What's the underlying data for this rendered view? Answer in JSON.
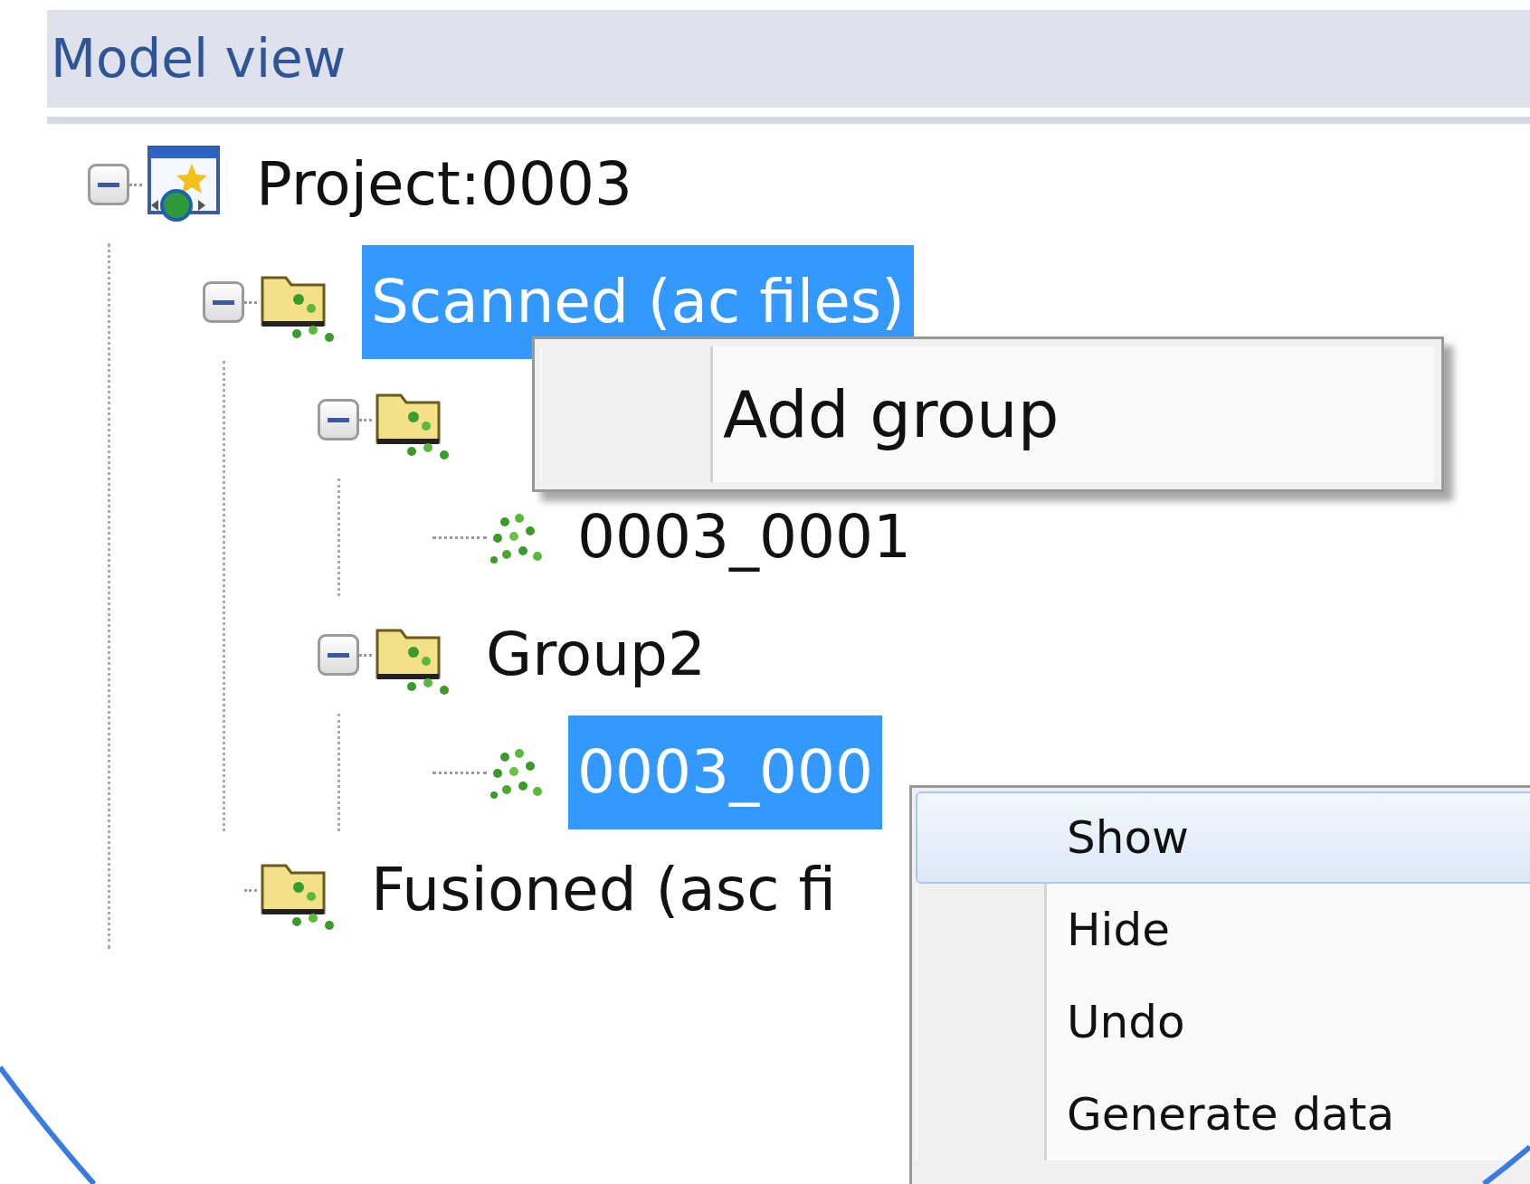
{
  "panel": {
    "title": "Model view"
  },
  "tree": [
    {
      "kind": "project",
      "label": "Project:0003",
      "expanded": true,
      "selected": false,
      "children": [
        {
          "kind": "folder",
          "label": "Scanned (ac files)",
          "expanded": true,
          "selected": true,
          "children": [
            {
              "kind": "folder",
              "expanded": true,
              "selected": false,
              "children": [
                {
                  "kind": "cloud",
                  "label": "0003_0001",
                  "selected": false
                }
              ]
            },
            {
              "kind": "folder",
              "label": "Group2",
              "expanded": true,
              "selected": false,
              "children": [
                {
                  "kind": "cloud",
                  "label": "0003_000",
                  "selected": true
                }
              ]
            }
          ]
        },
        {
          "kind": "folder",
          "label": "Fusioned (asc fi",
          "selected": false
        }
      ]
    }
  ],
  "context_menus": [
    {
      "items": [
        {
          "label": "Add group"
        }
      ]
    },
    {
      "items": [
        {
          "label": "Show",
          "selected": true
        },
        {
          "label": "Hide",
          "selected": false
        },
        {
          "label": "Undo",
          "selected": false
        },
        {
          "label": "Generate data",
          "selected": false
        }
      ]
    }
  ]
}
